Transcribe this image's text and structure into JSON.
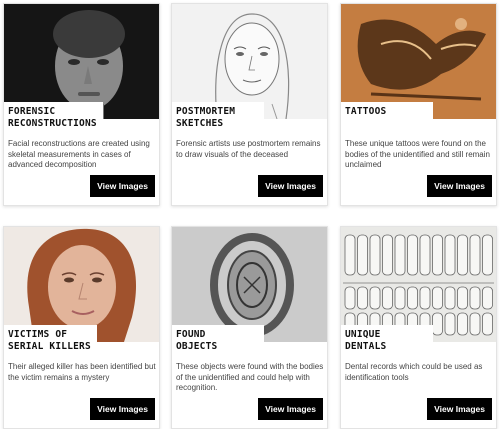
{
  "cards": [
    {
      "title": [
        "FORENSIC",
        "RECONSTRUCTIONS"
      ],
      "description": "Facial reconstructions are created using skeletal measurements in cases of advanced decomposition",
      "button": "View Images"
    },
    {
      "title": [
        "POSTMORTEM",
        "SKETCHES"
      ],
      "description": "Forensic artists use postmortem remains to draw visuals of the deceased",
      "button": "View Images"
    },
    {
      "title": [
        "TATTOOS"
      ],
      "description": "These unique tattoos were found on the bodies of the unidentified and still remain unclaimed",
      "button": "View Images"
    },
    {
      "title": [
        "VICTIMS OF",
        "SERIAL KILLERS"
      ],
      "description": "Their alleged killer has been identified but the victim remains a mystery",
      "button": "View Images"
    },
    {
      "title": [
        "FOUND",
        "OBJECTS"
      ],
      "description": "These objects were found with the bodies of the unidentified and could help with recognition.",
      "button": "View Images"
    },
    {
      "title": [
        "UNIQUE",
        "DENTALS"
      ],
      "description": "Dental records which could be used as identification tools",
      "button": "View Images"
    }
  ]
}
